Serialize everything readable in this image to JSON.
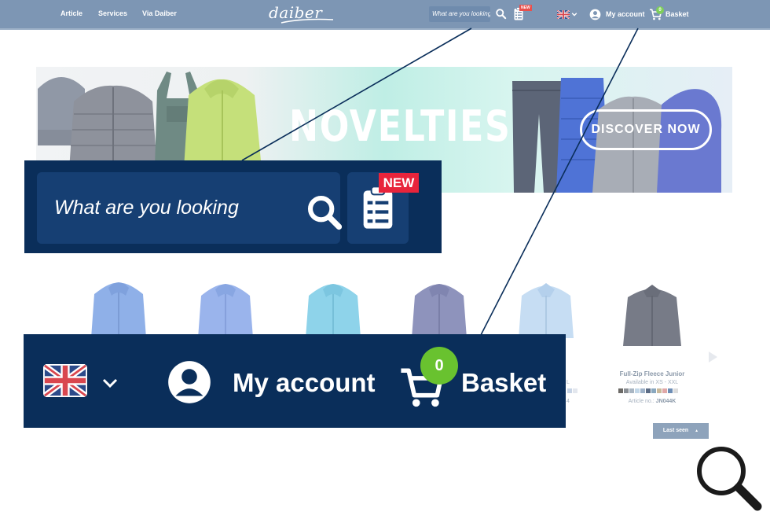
{
  "navbar": {
    "links": [
      "Article",
      "Services",
      "Via Daiber"
    ],
    "logo": "daiber",
    "search_placeholder": "What are you looking",
    "new_badge": "NEW",
    "account_label": "My account",
    "basket_count": "0",
    "basket_label": "Basket",
    "icons": [
      "search-icon",
      "checklist-icon",
      "uk-flag-icon",
      "chevron-down-icon",
      "account-icon",
      "cart-icon"
    ]
  },
  "banner": {
    "title": "NOVELTIES",
    "cta": "DISCOVER NOW"
  },
  "products": {
    "featured": {
      "title": "Full-Zip Fleece Junior",
      "sizes": "Available in XS - XXL",
      "article_prefix": "Article no.:",
      "article_no": "JN044K",
      "swatches": [
        "#6c6a67",
        "#8a8f95",
        "#a9b6c3",
        "#c2d7e8",
        "#9fb3c9",
        "#5d6d86",
        "#8aa8bf",
        "#c9b99b",
        "#e0a8a8",
        "#6d8db5",
        "#dcdcdc"
      ]
    },
    "partial_text": [
      "L",
      "4"
    ],
    "last_seen": "Last seen"
  },
  "zoom_search": {
    "placeholder": "What are you looking",
    "new_badge": "NEW"
  },
  "zoom_account": {
    "account_label": "My account",
    "basket_count": "0",
    "basket_label": "Basket"
  },
  "colors": {
    "navbar": "#7d96b4",
    "callout_bg": "#0a2e5a",
    "callout_field": "#163f73",
    "new_red": "#e8243b",
    "badge_green": "#69c22f"
  }
}
